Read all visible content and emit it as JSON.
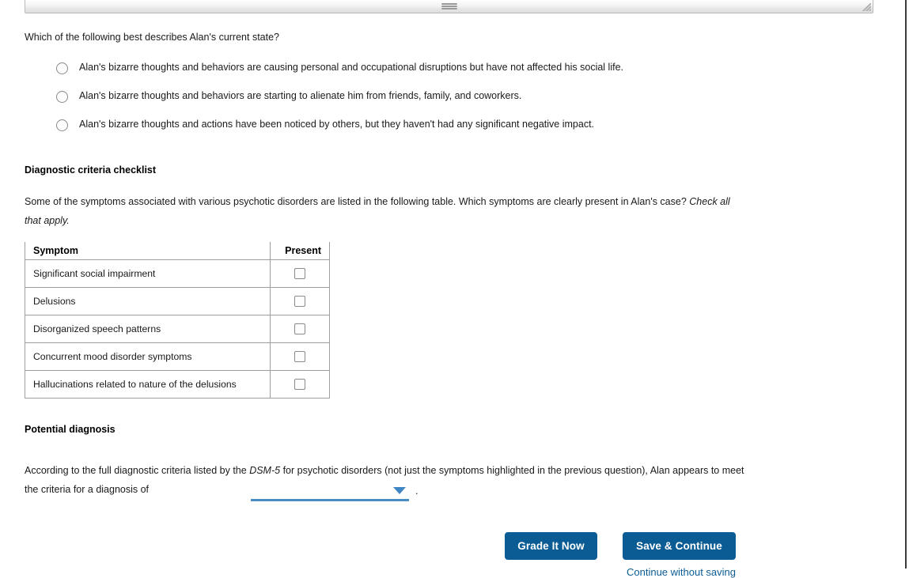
{
  "scrollbar": {
    "grip_icon": "horizontal-grip-icon",
    "resize_icon": "resize-grip-icon"
  },
  "question": {
    "prompt": "Which of the following best describes Alan's current state?",
    "options": [
      "Alan's bizarre thoughts and behaviors are causing personal and occupational disruptions but have not affected his social life.",
      "Alan's bizarre thoughts and behaviors are starting to alienate him from friends, family, and coworkers.",
      "Alan's bizarre thoughts and actions have been noticed by others, but they haven't had any significant negative impact."
    ]
  },
  "checklist_section": {
    "heading": "Diagnostic criteria checklist",
    "paragraph_before": "Some of the symptoms associated with various psychotic disorders are listed in the following table. Which symptoms are clearly present in Alan's case? ",
    "paragraph_italic": "Check all that apply.",
    "table": {
      "headers": [
        "Symptom",
        "Present"
      ],
      "rows": [
        {
          "symptom": "Significant social impairment",
          "present": false
        },
        {
          "symptom": "Delusions",
          "present": false
        },
        {
          "symptom": "Disorganized speech patterns",
          "present": false
        },
        {
          "symptom": "Concurrent mood disorder symptoms",
          "present": false
        },
        {
          "symptom": "Hallucinations related to nature of the delusions",
          "present": false
        }
      ]
    }
  },
  "diagnosis_section": {
    "heading": "Potential diagnosis",
    "paragraph_part1": "According to the full diagnostic criteria listed by the ",
    "paragraph_italic": "DSM-5",
    "paragraph_part2": " for psychotic disorders (not just the symptoms highlighted in the previous question), Alan appears to meet the criteria for a diagnosis of",
    "dropdown_value": "",
    "dropdown_caret_icon": "chevron-down-icon",
    "trailing_period": "."
  },
  "footer": {
    "grade_label": "Grade It Now",
    "save_label": "Save & Continue",
    "continue_link_label": "Continue without saving"
  },
  "colors": {
    "button_blue": "#0b5c94",
    "dropdown_blue": "#4a8bc2",
    "link_blue": "#0b5c94"
  }
}
